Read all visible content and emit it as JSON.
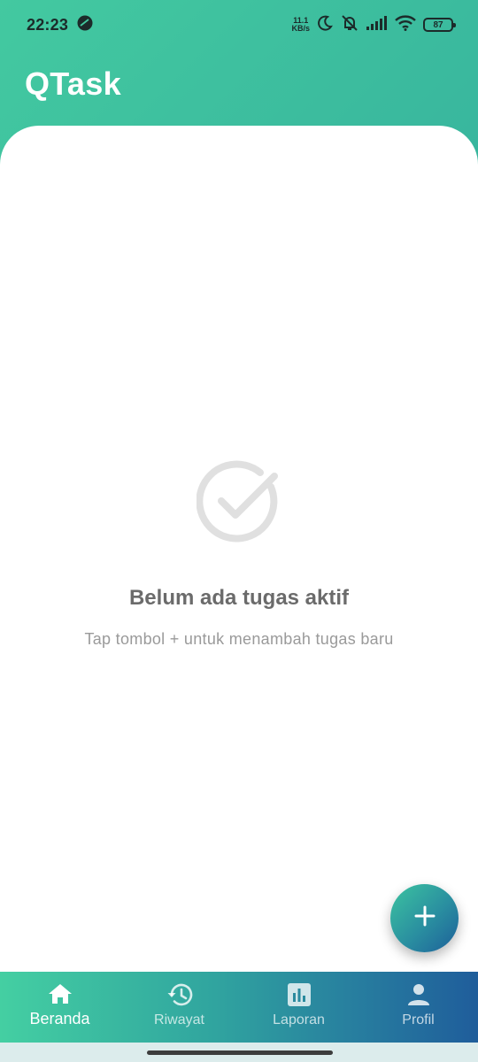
{
  "status_bar": {
    "time": "22:23",
    "net_speed_value": "11.1",
    "net_speed_unit": "KB/s",
    "battery": "87"
  },
  "app_bar": {
    "title": "QTask"
  },
  "empty_state": {
    "icon": "check-circle-icon",
    "title": "Belum ada tugas aktif",
    "subtitle": "Tap tombol + untuk menambah tugas baru"
  },
  "fab": {
    "icon": "plus-icon"
  },
  "bottom_nav": {
    "active_index": 0,
    "items": [
      {
        "label": "Beranda",
        "icon": "home-icon"
      },
      {
        "label": "Riwayat",
        "icon": "history-icon"
      },
      {
        "label": "Laporan",
        "icon": "report-icon"
      },
      {
        "label": "Profil",
        "icon": "person-icon"
      }
    ]
  },
  "colors": {
    "primary_start": "#43c9a0",
    "primary_end": "#1f5d9b",
    "empty_text": "#6b6b6b"
  }
}
